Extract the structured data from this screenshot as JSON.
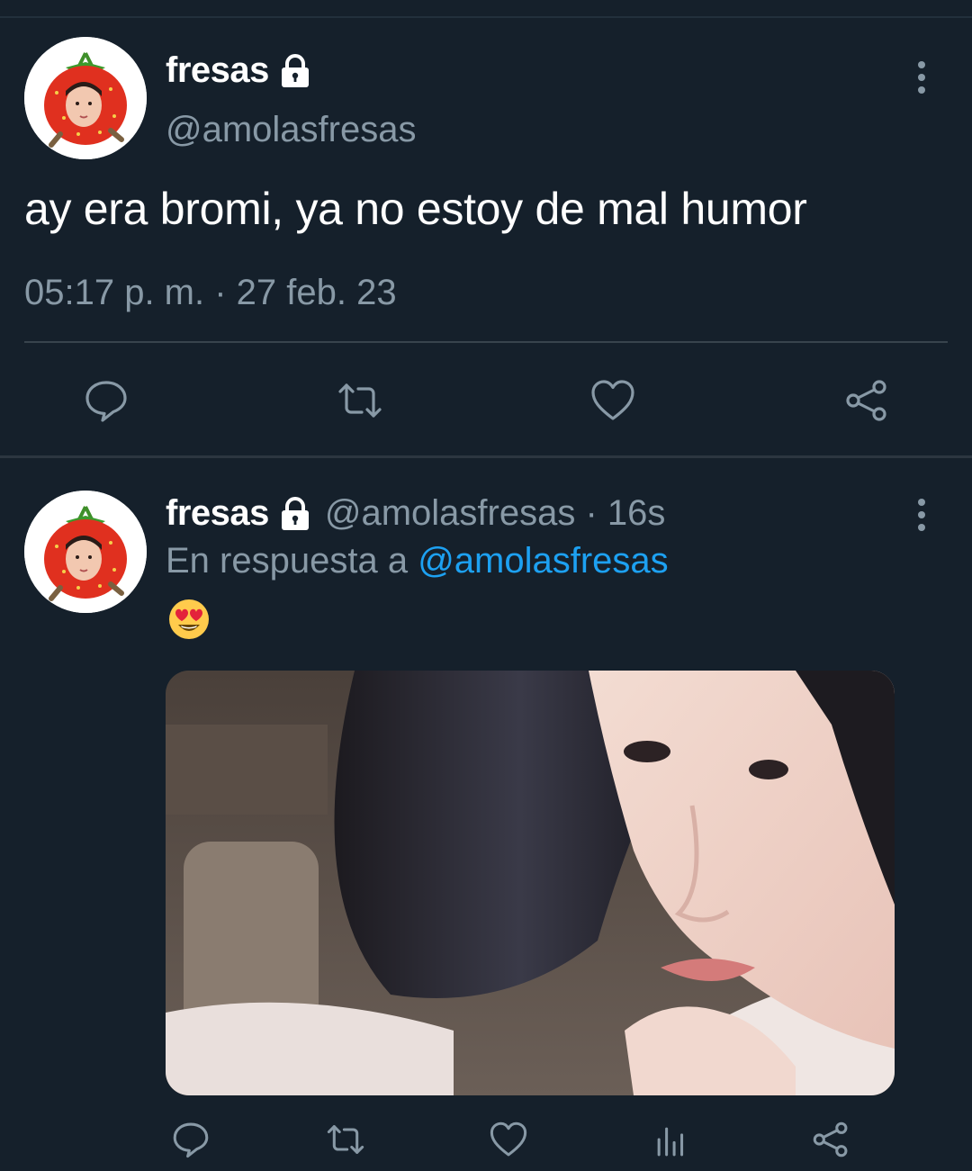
{
  "main_tweet": {
    "display_name": "fresas",
    "handle": "@amolasfresas",
    "text": "ay era bromi, ya no estoy de mal humor",
    "timestamp": "05:17 p. m. · 27 feb. 23",
    "actions": [
      "reply-icon",
      "retweet-icon",
      "like-icon",
      "share-icon"
    ]
  },
  "reply_tweet": {
    "display_name": "fresas",
    "handle_time": "@amolasfresas · 16s",
    "reply_prefix": "En respuesta a",
    "reply_handle": "@amolasfresas",
    "emoji": "smiling-face-heart-eyes",
    "actions": [
      "reply-icon",
      "retweet-icon",
      "like-icon",
      "analytics-icon",
      "share-icon"
    ]
  },
  "colors": {
    "background": "#15202b",
    "text": "#ffffff",
    "secondary": "#8899a6",
    "link": "#1da1f2",
    "divider": "#38444d"
  }
}
